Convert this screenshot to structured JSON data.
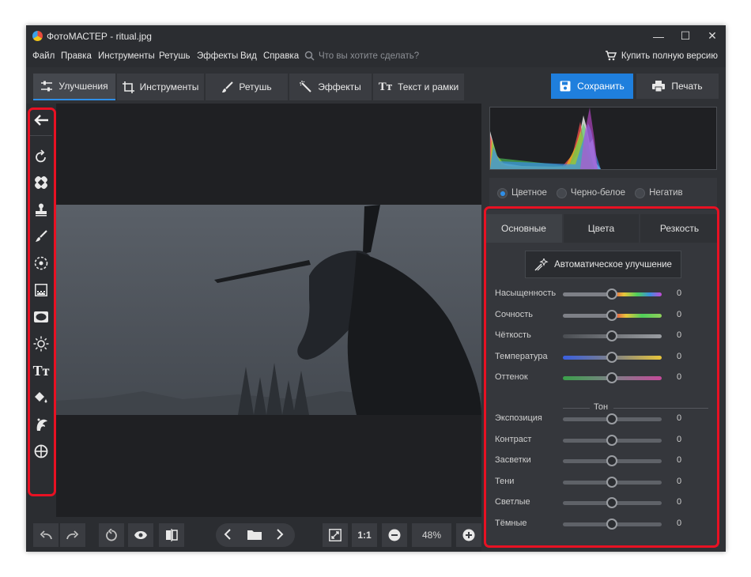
{
  "app": {
    "title": "ФотоМАСТЕР - ritual.jpg"
  },
  "window_controls": {
    "minimize": "—",
    "maximize": "☐",
    "close": "✕"
  },
  "menu": [
    "Файл",
    "Правка",
    "Инструменты",
    "Ретушь",
    "Эффекты",
    "Вид",
    "Справка"
  ],
  "search": {
    "placeholder": "Что вы хотите сделать?"
  },
  "buy": {
    "label": "Купить полную версию"
  },
  "main_tabs": [
    {
      "label": "Улучшения",
      "icon": "sliders-icon",
      "active": true
    },
    {
      "label": "Инструменты",
      "icon": "crop-icon",
      "active": false
    },
    {
      "label": "Ретушь",
      "icon": "brush-icon",
      "active": false
    },
    {
      "label": "Эффекты",
      "icon": "magic-wand-icon",
      "active": false
    },
    {
      "label": "Текст и рамки",
      "icon": "text-icon",
      "active": false
    }
  ],
  "actions": {
    "save_label": "Сохранить",
    "print_label": "Печать"
  },
  "left_tools": [
    "back-arrow-icon",
    "rotate-icon",
    "healing-patch-icon",
    "stamp-icon",
    "brush-icon",
    "radial-select-icon",
    "gradient-icon",
    "vignette-icon",
    "light-icon",
    "text-icon",
    "fill-bucket-icon",
    "portrait-icon",
    "target-icon"
  ],
  "color_modes": [
    {
      "label": "Цветное",
      "selected": true
    },
    {
      "label": "Черно-белое",
      "selected": false
    },
    {
      "label": "Негатив",
      "selected": false
    }
  ],
  "sub_tabs": [
    {
      "label": "Основные",
      "active": true
    },
    {
      "label": "Цвета",
      "active": false
    },
    {
      "label": "Резкость",
      "active": false
    }
  ],
  "auto_enhance": {
    "label": "Автоматическое улучшение"
  },
  "color_sliders": [
    {
      "label": "Насыщенность",
      "value": "0",
      "gradient": "linear-gradient(90deg,#7e8087,#7e8087 45%,#e04a4a 50%,#e8c53a 62%,#4fcf5a 75%,#3a8fe0 88%,#c54ad6)"
    },
    {
      "label": "Сочность",
      "value": "0",
      "gradient": "linear-gradient(90deg,#7e8087,#7e8087 45%,#e04a4a 52%,#e8c53a 64%,#4fcf5a 80%,#8fcf5a)"
    },
    {
      "label": "Чёткость",
      "value": "0",
      "gradient": "linear-gradient(90deg,#4a4d52,#9a9da2)"
    },
    {
      "label": "Температура",
      "value": "0",
      "gradient": "linear-gradient(90deg,#3a5fe0,#7e8087 50%,#e8c53a)"
    },
    {
      "label": "Оттенок",
      "value": "0",
      "gradient": "linear-gradient(90deg,#3aa04a,#7e8087 50%,#c54a9a)"
    }
  ],
  "tone": {
    "title": "Тон",
    "sliders": [
      {
        "label": "Экспозиция",
        "value": "0"
      },
      {
        "label": "Контраст",
        "value": "0"
      },
      {
        "label": "Засветки",
        "value": "0"
      },
      {
        "label": "Тени",
        "value": "0"
      },
      {
        "label": "Светлые",
        "value": "0"
      },
      {
        "label": "Тёмные",
        "value": "0"
      }
    ]
  },
  "bottom_bar": {
    "zoom_1to1": "1:1",
    "zoom_value": "48%"
  },
  "colors": {
    "accent": "#1f7fdd",
    "highlight_border": "#e81123"
  }
}
